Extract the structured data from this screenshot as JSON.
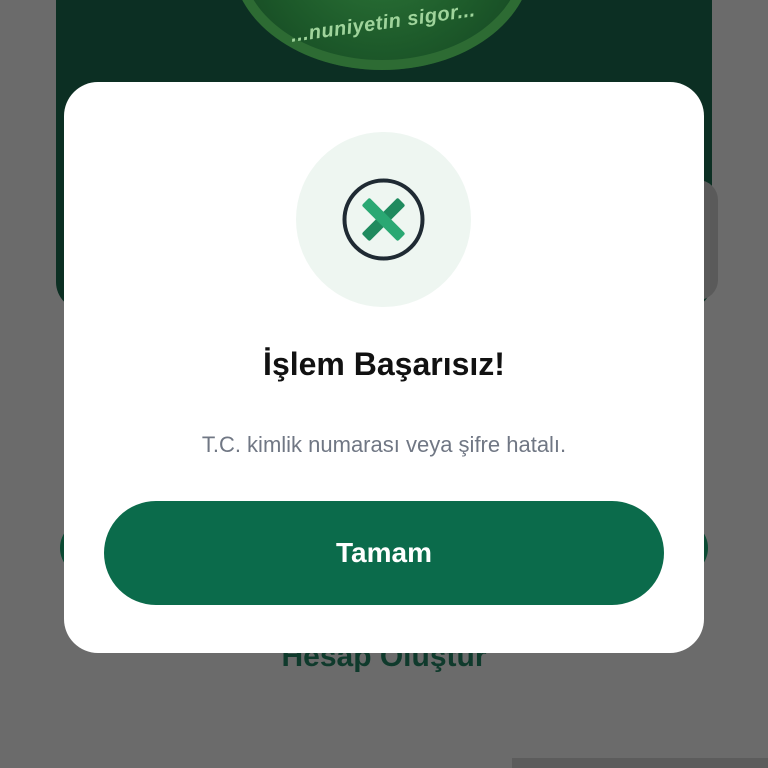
{
  "background": {
    "badge_text": "...nuniyetin sigor...",
    "link_text": "Hesap Oluştur"
  },
  "dialog": {
    "icon": "x-circle-icon",
    "title": "İşlem Başarısız!",
    "message": "T.C. kimlik numarası veya şifre hatalı.",
    "confirm_label": "Tamam"
  },
  "colors": {
    "primary": "#0b6b4b",
    "icon_halo": "#eef6f1",
    "overlay": "#6b6b6b",
    "message_text": "#707784"
  }
}
